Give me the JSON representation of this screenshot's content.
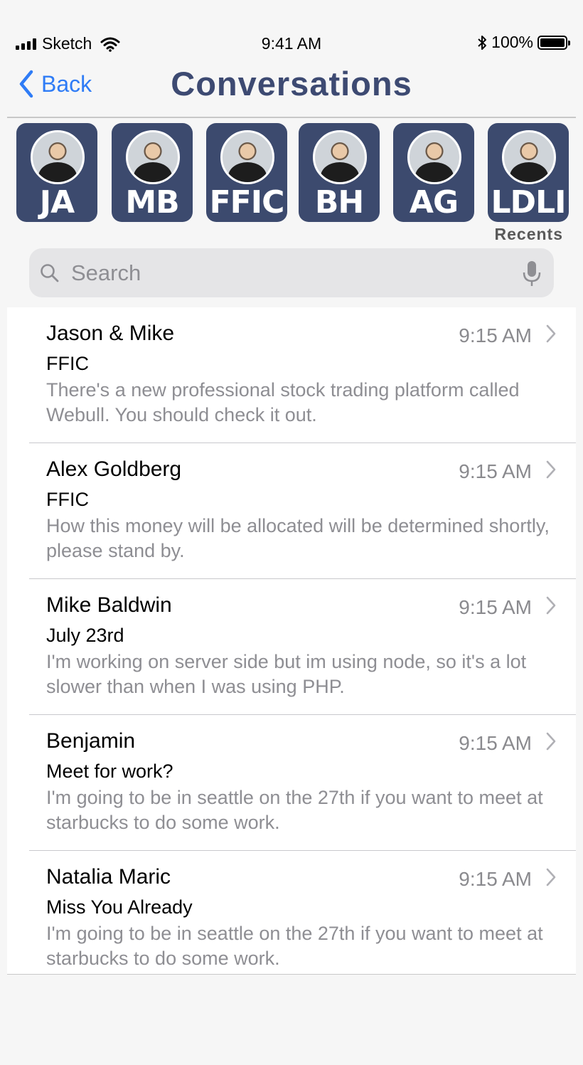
{
  "status_bar": {
    "carrier": "Sketch",
    "time": "9:41 AM",
    "battery": "100%",
    "battery_level": 1.0
  },
  "nav": {
    "back_label": "Back",
    "title": "Conversations"
  },
  "recents": {
    "label": "Recents",
    "items": [
      {
        "initials": "JA"
      },
      {
        "initials": "MB"
      },
      {
        "initials": "FFIC"
      },
      {
        "initials": "BH"
      },
      {
        "initials": "AG"
      },
      {
        "initials": "LDLI"
      }
    ]
  },
  "search": {
    "placeholder": "Search"
  },
  "conversations": [
    {
      "name": "Jason & Mike",
      "time": "9:15 AM",
      "subject": "FFIC",
      "preview": "There's a new professional stock trading platform called Webull. You should check it out."
    },
    {
      "name": "Alex Goldberg",
      "time": "9:15 AM",
      "subject": "FFIC",
      "preview": "How this money will be allocated will be determined shortly, please stand by."
    },
    {
      "name": "Mike Baldwin",
      "time": "9:15 AM",
      "subject": "July 23rd",
      "preview": "I'm working on server side but im using node, so it's a lot slower than when I was using PHP."
    },
    {
      "name": "Benjamin",
      "time": "9:15 AM",
      "subject": "Meet for work?",
      "preview": "I'm going to be in seattle on the 27th if you want to meet at starbucks to do some work."
    },
    {
      "name": "Natalia Maric",
      "time": "9:15 AM",
      "subject": "Miss You Already",
      "preview": "I'm going to be in seattle on the 27th if you want to meet at starbucks to do some work."
    }
  ],
  "colors": {
    "accent": "#2f7cf6",
    "brand": "#3d4a72",
    "tile": "#3c4a6e"
  }
}
